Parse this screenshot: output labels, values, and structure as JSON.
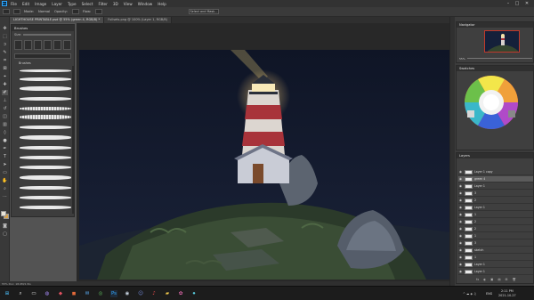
{
  "menubar": {
    "app_badge": "Ps",
    "items": [
      "File",
      "Edit",
      "Image",
      "Layer",
      "Type",
      "Select",
      "Filter",
      "3D",
      "View",
      "Window",
      "Help"
    ],
    "minimize": "–",
    "maximize": "□",
    "close": "✕"
  },
  "options": {
    "items": [
      "Mode:",
      "Normal",
      "Opacity:",
      "Flow:"
    ],
    "select_button": "Select and Mask..."
  },
  "tabs": [
    {
      "label": "LIGHTHOUSE PRINTABLE.psd @ 55% (green 4, RGB/8) *",
      "active": true
    },
    {
      "label": "Fullsets.png @ 100% (Layer 1, RGB/8)",
      "active": false
    }
  ],
  "brush_panel": {
    "title": "Brushes",
    "size_label": "Size:",
    "folder_label": "Brushes"
  },
  "dock": {
    "navigator_title": "Navigator",
    "nav_zoom": "55%",
    "swatches_title": "Swatches",
    "layers_title": "Layers",
    "layers": [
      {
        "name": "Layer 1 copy",
        "selected": false
      },
      {
        "name": "green 4",
        "selected": true
      },
      {
        "name": "Layer 1",
        "selected": false
      },
      {
        "name": "3",
        "selected": false
      },
      {
        "name": "2",
        "selected": false
      },
      {
        "name": "Layer 1",
        "selected": false
      },
      {
        "name": "1",
        "selected": false
      },
      {
        "name": "2",
        "selected": false
      },
      {
        "name": "2",
        "selected": false
      },
      {
        "name": "1",
        "selected": false
      },
      {
        "name": "3",
        "selected": false
      },
      {
        "name": "sketch",
        "selected": false
      },
      {
        "name": "1",
        "selected": false
      },
      {
        "name": "Layer 1",
        "selected": false
      },
      {
        "name": "Layer 1",
        "selected": false
      }
    ],
    "layer_tools": [
      "fx",
      "◐",
      "▣",
      "▤",
      "⊞",
      "🗑"
    ]
  },
  "statusbar": {
    "text": "55%  Doc: 18.0M/1.5G"
  },
  "taskbar": {
    "icons": [
      "windows-icon",
      "search-icon",
      "taskview-icon",
      "chat-icon",
      "explorer-icon",
      "store-icon",
      "mail-icon",
      "chrome-icon",
      "photoshop-icon",
      "steam-icon",
      "discord-icon",
      "music-icon",
      "folder-icon",
      "paint-icon",
      "recorder-icon"
    ],
    "tray_lang": "ENG",
    "time": "2:11 PM",
    "date": "2021-10-27"
  },
  "colors": {
    "app_bg": "#535353",
    "accent": "#31a8ff",
    "sky": "#121a2c",
    "lighthouse_red": "#a8333a"
  }
}
